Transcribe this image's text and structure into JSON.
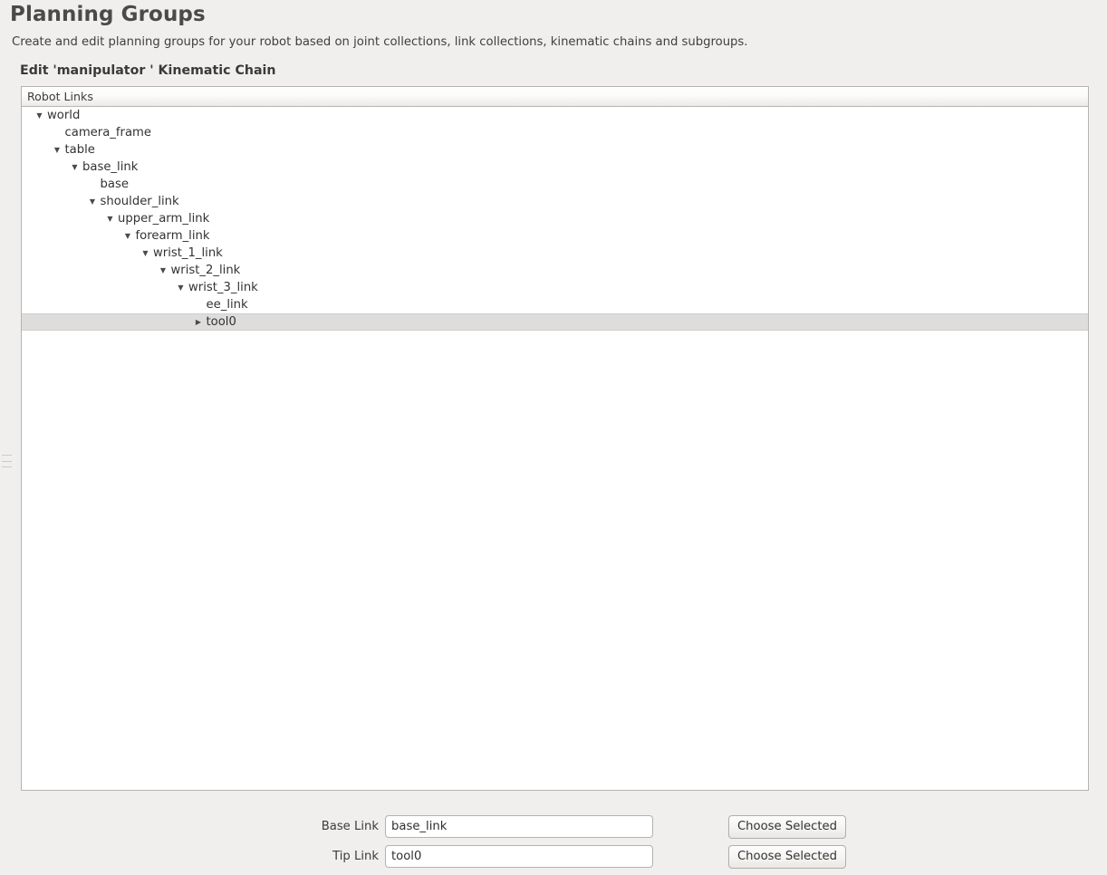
{
  "page": {
    "title": "Planning Groups",
    "subtitle": "Create and edit planning groups for your robot based on joint collections, link collections, kinematic chains and subgroups.",
    "section_heading": "Edit 'manipulator ' Kinematic Chain"
  },
  "colors": {
    "background": "#f0efed",
    "panel": "#ffffff",
    "border": "#b6b4b1",
    "selection": "#dedddb",
    "text": "#3c3c3c"
  },
  "tree": {
    "column_header": "Robot Links",
    "nodes": [
      {
        "label": "world",
        "depth": 0,
        "twisty": "expanded",
        "selected": false
      },
      {
        "label": "camera_frame",
        "depth": 1,
        "twisty": "leaf",
        "selected": false
      },
      {
        "label": "table",
        "depth": 1,
        "twisty": "expanded",
        "selected": false
      },
      {
        "label": "base_link",
        "depth": 2,
        "twisty": "expanded",
        "selected": false
      },
      {
        "label": "base",
        "depth": 3,
        "twisty": "leaf",
        "selected": false
      },
      {
        "label": "shoulder_link",
        "depth": 3,
        "twisty": "expanded",
        "selected": false
      },
      {
        "label": "upper_arm_link",
        "depth": 4,
        "twisty": "expanded",
        "selected": false
      },
      {
        "label": "forearm_link",
        "depth": 5,
        "twisty": "expanded",
        "selected": false
      },
      {
        "label": "wrist_1_link",
        "depth": 6,
        "twisty": "expanded",
        "selected": false
      },
      {
        "label": "wrist_2_link",
        "depth": 7,
        "twisty": "expanded",
        "selected": false
      },
      {
        "label": "wrist_3_link",
        "depth": 8,
        "twisty": "expanded",
        "selected": false
      },
      {
        "label": "ee_link",
        "depth": 9,
        "twisty": "leaf",
        "selected": false
      },
      {
        "label": "tool0",
        "depth": 9,
        "twisty": "collapsed",
        "selected": true
      }
    ]
  },
  "form": {
    "base_link": {
      "label": "Base Link",
      "value": "base_link",
      "button": "Choose Selected"
    },
    "tip_link": {
      "label": "Tip Link",
      "value": "tool0",
      "button": "Choose Selected"
    }
  }
}
